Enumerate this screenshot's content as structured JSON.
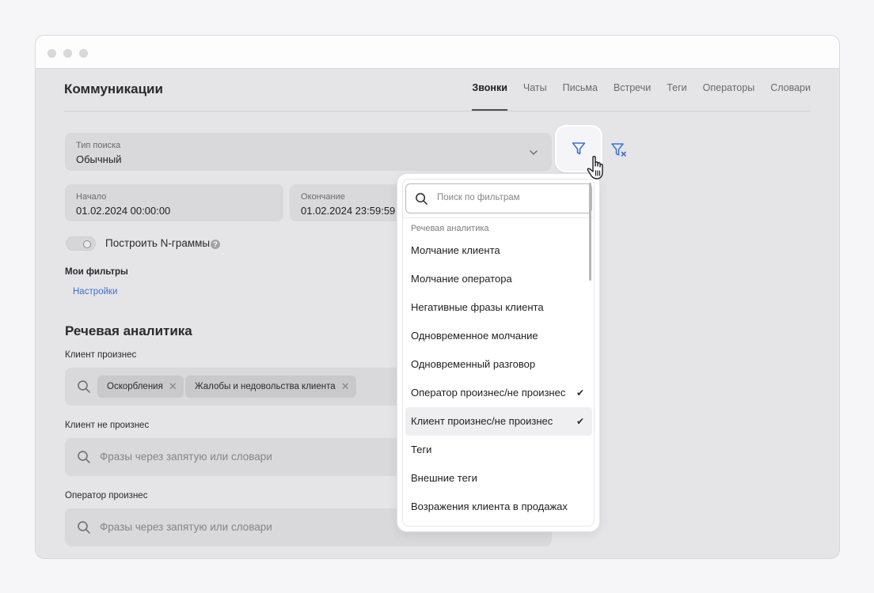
{
  "header": {
    "title": "Коммуникации",
    "tabs": [
      {
        "label": "Звонки",
        "active": true
      },
      {
        "label": "Чаты",
        "active": false
      },
      {
        "label": "Письма",
        "active": false
      },
      {
        "label": "Встречи",
        "active": false
      },
      {
        "label": "Теги",
        "active": false
      },
      {
        "label": "Операторы",
        "active": false
      },
      {
        "label": "Словари",
        "active": false
      }
    ]
  },
  "search_type": {
    "label": "Тип поиска",
    "value": "Обычный"
  },
  "period": {
    "start": {
      "label": "Начало",
      "value": "01.02.2024 00:00:00"
    },
    "end": {
      "label": "Окончание",
      "value": "01.02.2024 23:59:59"
    }
  },
  "ngrams": {
    "label": "Построить N-граммы",
    "enabled": false,
    "help": "?"
  },
  "my_filters": {
    "title": "Мои фильтры",
    "settings_link": "Настройки"
  },
  "speech_analytics": {
    "title": "Речевая аналитика",
    "client_said": {
      "label": "Клиент произнес",
      "chips": [
        "Оскорбления",
        "Жалобы и недовольства клиента"
      ]
    },
    "client_not_said": {
      "label": "Клиент не произнес",
      "placeholder": "Фразы через запятую или словари"
    },
    "operator_said": {
      "label": "Оператор произнес",
      "placeholder": "Фразы через запятую или словари"
    }
  },
  "filter_dropdown": {
    "search_placeholder": "Поиск по фильтрам",
    "group_title": "Речевая аналитика",
    "items": [
      {
        "label": "Молчание клиента",
        "checked": false
      },
      {
        "label": "Молчание оператора",
        "checked": false
      },
      {
        "label": "Негативные фразы клиента",
        "checked": false
      },
      {
        "label": "Одновременное молчание",
        "checked": false
      },
      {
        "label": "Одновременный разговор",
        "checked": false
      },
      {
        "label": "Оператор произнес/не произнес",
        "checked": true
      },
      {
        "label": "Клиент произнес/не произнес",
        "checked": true,
        "hovered": true
      },
      {
        "label": "Теги",
        "checked": false
      },
      {
        "label": "Внешние теги",
        "checked": false
      },
      {
        "label": "Возражения клиента в продажах",
        "checked": false
      }
    ]
  },
  "colors": {
    "accent": "#3c6fd6",
    "background": "#e5e5e7",
    "field": "#d9d9dc"
  }
}
